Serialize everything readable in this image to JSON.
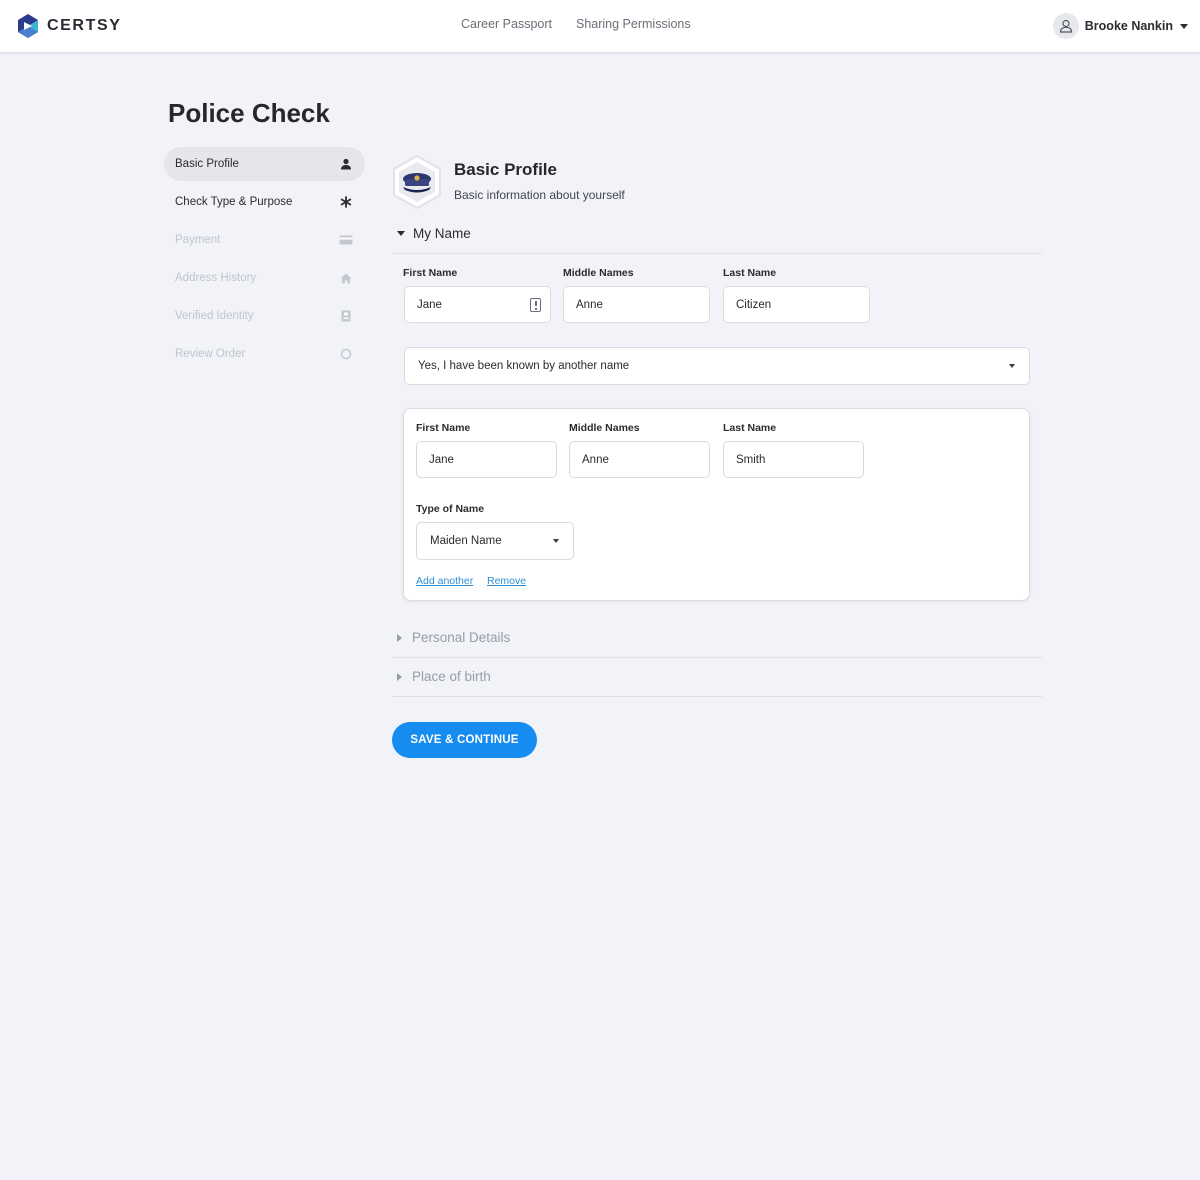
{
  "brand": {
    "name": "CERTSY",
    "colors": {
      "logo_dark": "#2e3a8c",
      "logo_light": "#3fb5d6",
      "accent": "#168cf0",
      "link": "#2f8fd6"
    }
  },
  "nav": {
    "links": [
      {
        "label": "Career Passport"
      },
      {
        "label": "Sharing Permissions"
      }
    ],
    "user": {
      "name": "Brooke Nankin",
      "icon": "user-icon"
    }
  },
  "page": {
    "title": "Police Check"
  },
  "sidebar": {
    "items": [
      {
        "label": "Basic Profile",
        "icon": "user-icon",
        "state": "active"
      },
      {
        "label": "Check Type & Purpose",
        "icon": "asterisk-icon",
        "state": "done"
      },
      {
        "label": "Payment",
        "icon": "credit-card-icon",
        "state": "pending"
      },
      {
        "label": "Address History",
        "icon": "home-icon",
        "state": "pending"
      },
      {
        "label": "Verified Identity",
        "icon": "id-card-icon",
        "state": "pending"
      },
      {
        "label": "Review Order",
        "icon": "circle-icon",
        "state": "pending"
      }
    ]
  },
  "section": {
    "title": "Basic Profile",
    "subtitle": "Basic information about yourself",
    "badge_icon": "police-cap-icon"
  },
  "my_name": {
    "heading": "My Name",
    "first_name": {
      "label": "First Name",
      "value": "Jane"
    },
    "middle_names": {
      "label": "Middle Names",
      "value": "Anne"
    },
    "last_name": {
      "label": "Last Name",
      "value": "Citizen"
    },
    "known_by_other": {
      "selected": "Yes, I have been known by another name"
    },
    "other_name": {
      "first_name": {
        "label": "First Name",
        "value": "Jane"
      },
      "middle_names": {
        "label": "Middle Names",
        "value": "Anne"
      },
      "last_name": {
        "label": "Last Name",
        "value": "Smith"
      },
      "type_of_name": {
        "label": "Type of Name",
        "selected": "Maiden Name"
      },
      "add_another": "Add another",
      "remove": "Remove"
    }
  },
  "collapsed_sections": [
    {
      "label": "Personal Details"
    },
    {
      "label": "Place of birth"
    }
  ],
  "actions": {
    "save_continue": "SAVE & CONTINUE"
  }
}
